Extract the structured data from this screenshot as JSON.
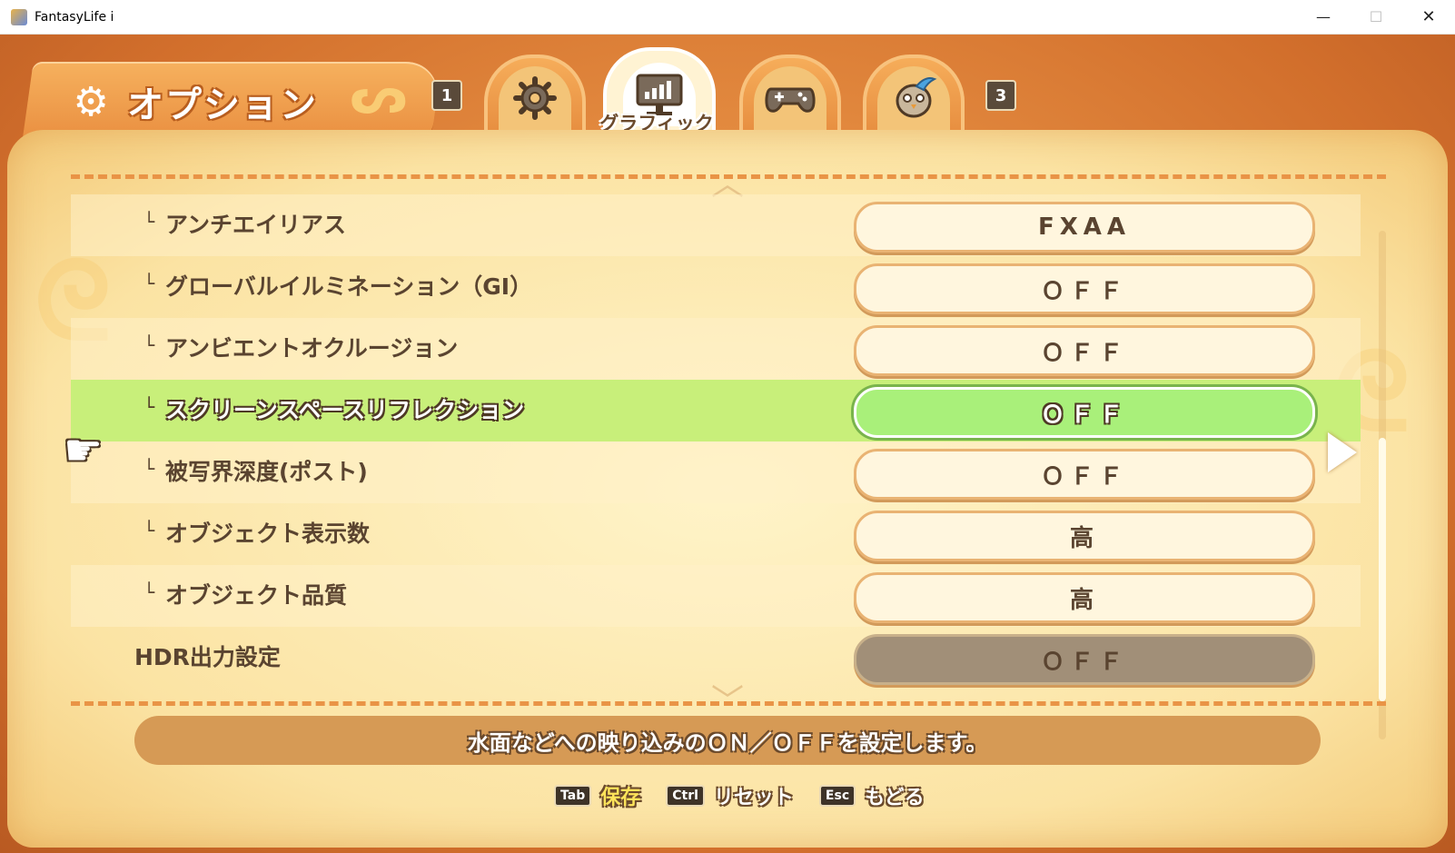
{
  "window": {
    "title": "FantasyLife i",
    "minimize": "—",
    "maximize": "☐",
    "close": "✕"
  },
  "header": {
    "title": "オプション",
    "left_key": "1",
    "right_key": "3"
  },
  "tabs": [
    {
      "id": "general",
      "icon": "gear-icon",
      "label": ""
    },
    {
      "id": "graphics",
      "icon": "monitor-icon",
      "label": "グラフィック",
      "active": true
    },
    {
      "id": "controller",
      "icon": "gamepad-icon",
      "label": ""
    },
    {
      "id": "character",
      "icon": "bird-character-icon",
      "label": ""
    }
  ],
  "rows": [
    {
      "label": "アンチエイリアス",
      "value": "FXAA",
      "branch": true
    },
    {
      "label": "グローバルイルミネーション（GI）",
      "value": "ＯＦＦ",
      "branch": true
    },
    {
      "label": "アンビエントオクルージョン",
      "value": "ＯＦＦ",
      "branch": true
    },
    {
      "label": "スクリーンスペースリフレクション",
      "value": "ＯＦＦ",
      "branch": true,
      "selected": true
    },
    {
      "label": "被写界深度(ポスト)",
      "value": "ＯＦＦ",
      "branch": true
    },
    {
      "label": "オブジェクト表示数",
      "value": "高",
      "branch": true
    },
    {
      "label": "オブジェクト品質",
      "value": "高",
      "branch": true
    },
    {
      "label": "HDR出力設定",
      "value": "ＯＦＦ",
      "branch": false,
      "disabled": true
    }
  ],
  "branch_glyph": "└",
  "description": "水面などへの映り込みのＯＮ／ＯＦＦを設定します。",
  "controls": [
    {
      "key": "Tab",
      "label": "保存",
      "primary": true
    },
    {
      "key": "Ctrl",
      "label": "リセット"
    },
    {
      "key": "Esc",
      "label": "もどる"
    }
  ],
  "colors": {
    "selected_row": "#c8ef7a",
    "selected_pill": "#a9f07a",
    "frame": "#d97a36",
    "panel": "#fbe3a3"
  }
}
